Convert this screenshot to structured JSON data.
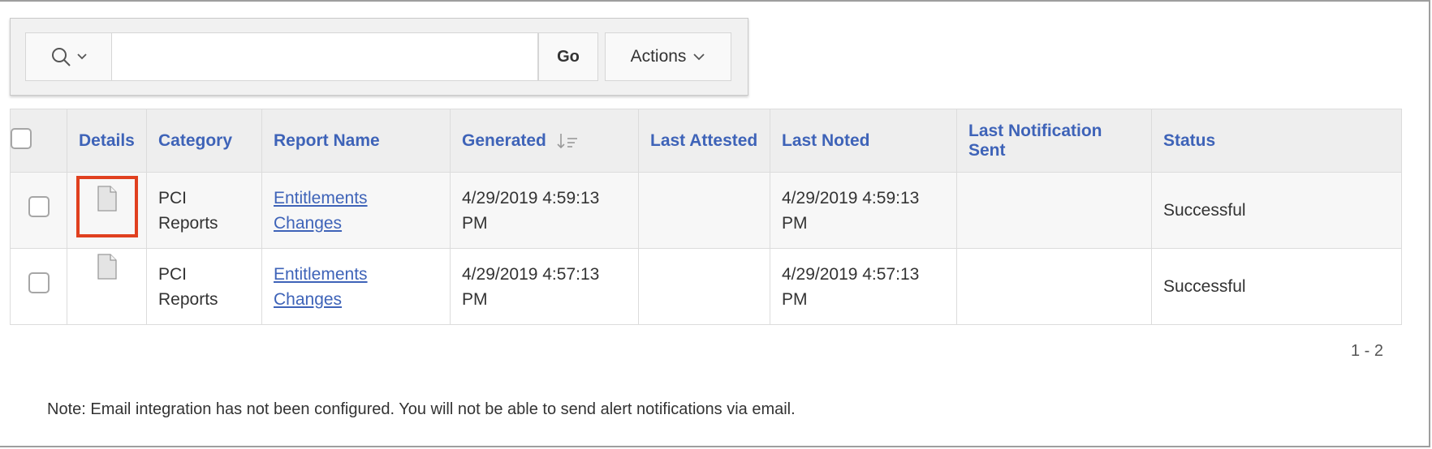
{
  "toolbar": {
    "go_label": "Go",
    "actions_label": "Actions",
    "search_value": ""
  },
  "table": {
    "columns": [
      "Details",
      "Category",
      "Report Name",
      "Generated",
      "Last Attested",
      "Last Noted",
      "Last Notification Sent",
      "Status"
    ],
    "rows": [
      {
        "category_line1": "PCI",
        "category_line2": "Reports",
        "report_line1": "Entitlements",
        "report_line2": "Changes",
        "generated_line1": "4/29/2019 4:59:13",
        "generated_line2": "PM",
        "last_attested": "",
        "last_noted_line1": "4/29/2019 4:59:13",
        "last_noted_line2": "PM",
        "last_notification_sent": "",
        "status": "Successful"
      },
      {
        "category_line1": "PCI",
        "category_line2": "Reports",
        "report_line1": "Entitlements",
        "report_line2": "Changes",
        "generated_line1": "4/29/2019 4:57:13",
        "generated_line2": "PM",
        "last_attested": "",
        "last_noted_line1": "4/29/2019 4:57:13",
        "last_noted_line2": "PM",
        "last_notification_sent": "",
        "status": "Successful"
      }
    ]
  },
  "pagination": "1 - 2",
  "note": "Note: Email integration has not been configured. You will not be able to send alert notifications via email.",
  "colors": {
    "header_link": "#3e63b8",
    "highlight": "#e0401f"
  },
  "icons": [
    "search-icon",
    "chevron-down-icon",
    "document-icon",
    "sort-descending-icon"
  ]
}
